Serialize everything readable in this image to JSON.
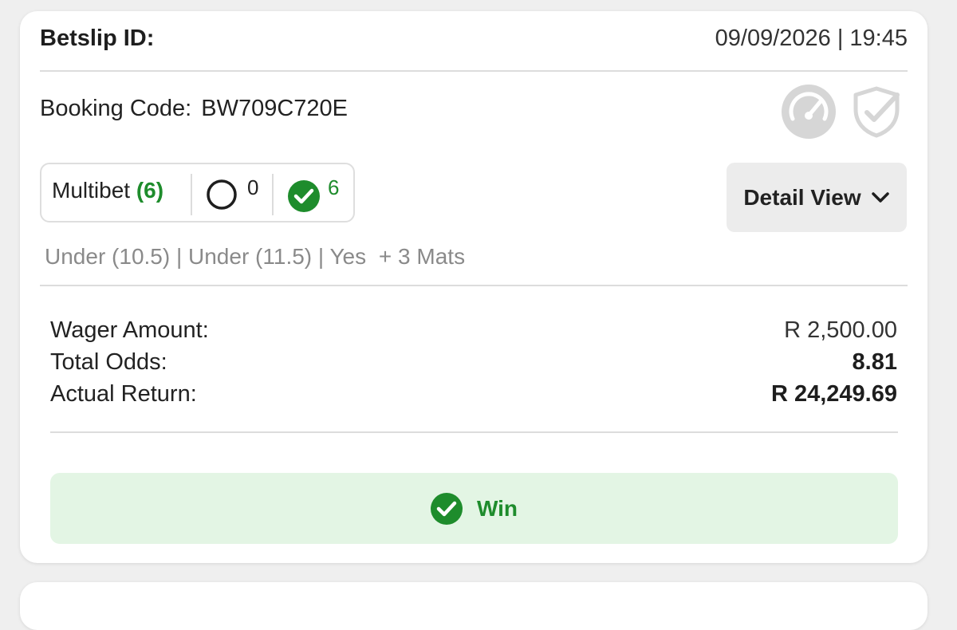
{
  "header": {
    "title": "Betslip ID:",
    "datetime": "09/09/2026 | 19:45"
  },
  "booking": {
    "label": "Booking Code:",
    "code": "BW709C720E"
  },
  "icons": {
    "gauge": "speedometer-icon",
    "shield": "shield-check-icon"
  },
  "multibet": {
    "label": "Multibet",
    "count": "(6)",
    "open_count": "0",
    "won_count": "6"
  },
  "detail_view": {
    "label": "Detail View"
  },
  "selections": "Under (10.5) | Under (11.5) | Yes",
  "more_mats": "+ 3 Mats",
  "summary": {
    "wager_label": "Wager Amount:",
    "wager_value": "R 2,500.00",
    "odds_label": "Total Odds:",
    "odds_value": "8.81",
    "return_label": "Actual Return:",
    "return_value": "R 24,249.69"
  },
  "result": {
    "label": "Win"
  },
  "colors": {
    "accent_green": "#1e8c2c",
    "win_bg": "#e3f5e4",
    "muted": "#8a8a8a"
  }
}
